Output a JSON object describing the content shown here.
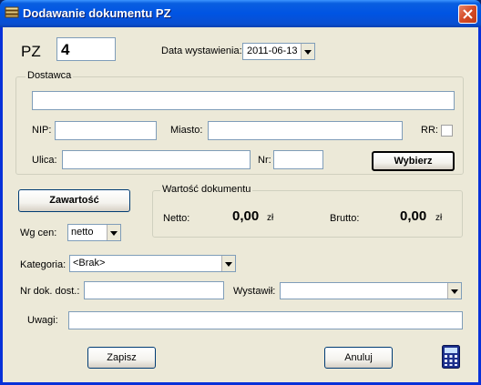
{
  "window": {
    "title": "Dodawanie dokumentu PZ",
    "title_icon": "document-stack-icon",
    "close_icon": "close-icon"
  },
  "header": {
    "pz_label": "PZ",
    "pz_number": "4",
    "date_label": "Data wystawienia:",
    "date_value": "2011-06-13"
  },
  "supplier": {
    "group_title": "Dostawca",
    "name_value": "",
    "nip_label": "NIP:",
    "nip_value": "",
    "city_label": "Miasto:",
    "city_value": "",
    "rr_label": "RR:",
    "rr_checked": false,
    "street_label": "Ulica:",
    "street_value": "",
    "nr_label": "Nr:",
    "nr_value": "",
    "choose_button": "Wybierz"
  },
  "contents": {
    "button": "Zawartość",
    "price_label": "Wg cen:",
    "price_value": "netto"
  },
  "value": {
    "group_title": "Wartość dokumentu",
    "net_label": "Netto:",
    "net_amount": "0,00",
    "net_unit": "zł",
    "gross_label": "Brutto:",
    "gross_amount": "0,00",
    "gross_unit": "zł"
  },
  "details": {
    "category_label": "Kategoria:",
    "category_value": "<Brak>",
    "doc_nr_label": "Nr dok. dost.:",
    "doc_nr_value": "",
    "issuer_label": "Wystawił:",
    "issuer_value": "",
    "notes_label": "Uwagi:",
    "notes_value": ""
  },
  "footer": {
    "save_button": "Zapisz",
    "cancel_button": "Anuluj",
    "calculator_icon": "calculator-icon"
  }
}
